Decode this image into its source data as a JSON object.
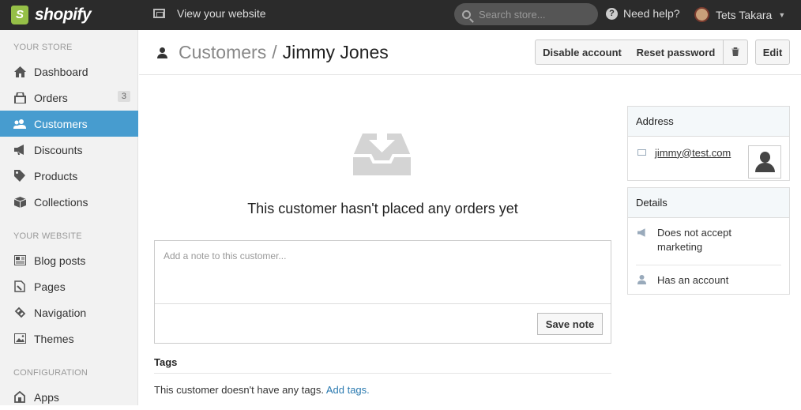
{
  "topbar": {
    "brand": "shopify",
    "view_site": "View your website",
    "search_placeholder": "Search store...",
    "help": "Need help?",
    "user": "Tets Takara"
  },
  "sidebar": {
    "sections": {
      "store": "YOUR STORE",
      "website": "YOUR WEBSITE",
      "config": "CONFIGURATION"
    },
    "items": [
      {
        "label": "Dashboard",
        "icon": "home-icon"
      },
      {
        "label": "Orders",
        "icon": "inbox-icon",
        "badge": "3"
      },
      {
        "label": "Customers",
        "icon": "users-icon",
        "active": true
      },
      {
        "label": "Discounts",
        "icon": "megaphone-icon"
      },
      {
        "label": "Products",
        "icon": "tag-icon"
      },
      {
        "label": "Collections",
        "icon": "box-icon"
      },
      {
        "label": "Blog posts",
        "icon": "newspaper-icon"
      },
      {
        "label": "Pages",
        "icon": "pages-icon"
      },
      {
        "label": "Navigation",
        "icon": "link-icon"
      },
      {
        "label": "Themes",
        "icon": "image-icon"
      },
      {
        "label": "Apps",
        "icon": "apps-icon"
      }
    ]
  },
  "header": {
    "parent": "Customers",
    "separator": "/",
    "current": "Jimmy Jones",
    "buttons": {
      "disable": "Disable account",
      "reset": "Reset password",
      "delete_icon": "trash-icon",
      "edit": "Edit"
    }
  },
  "main": {
    "empty_text": "This customer hasn't placed any orders yet",
    "note_placeholder": "Add a note to this customer...",
    "save_note": "Save note",
    "tags_title": "Tags",
    "tags_text": "This customer doesn't have any tags.",
    "tags_link": "Add tags."
  },
  "address": {
    "title": "Address",
    "email": "jimmy@test.com"
  },
  "details": {
    "title": "Details",
    "marketing": "Does not accept marketing",
    "account": "Has an account"
  },
  "colors": {
    "active": "#479ccf",
    "brand": "#95bf47",
    "topbar": "#2b2b2b",
    "link": "#2a7ab0"
  }
}
